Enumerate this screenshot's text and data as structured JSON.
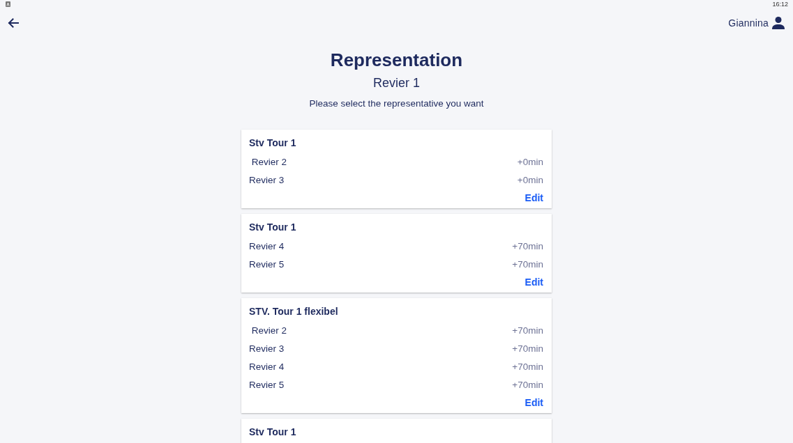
{
  "status_bar": {
    "time": "16:12"
  },
  "header": {
    "user_name": "Giannina"
  },
  "title": "Representation",
  "subtitle": "Revier 1",
  "instruction": "Please select the representative you want",
  "representatives": [
    {
      "name": "Stv Tour 1",
      "areas": [
        {
          "name": " Revier 2",
          "offset": "+0min"
        },
        {
          "name": "Revier 3",
          "offset": "+0min"
        }
      ],
      "action": "Edit"
    },
    {
      "name": "Stv Tour 1",
      "areas": [
        {
          "name": "Revier 4",
          "offset": "+70min"
        },
        {
          "name": "Revier 5",
          "offset": "+70min"
        }
      ],
      "action": "Edit"
    },
    {
      "name": "STV. Tour 1 flexibel",
      "areas": [
        {
          "name": " Revier 2",
          "offset": "+70min"
        },
        {
          "name": "Revier 3",
          "offset": "+70min"
        },
        {
          "name": "Revier 4",
          "offset": "+70min"
        },
        {
          "name": "Revier 5",
          "offset": "+70min"
        }
      ],
      "action": "Edit"
    },
    {
      "name": "Stv Tour 1"
    }
  ]
}
